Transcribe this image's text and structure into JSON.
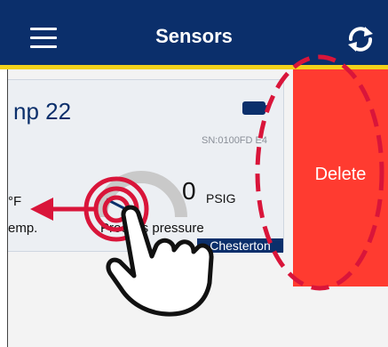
{
  "header": {
    "title": "Sensors",
    "menu_icon": "hamburger-menu-icon",
    "refresh_icon": "refresh-icon",
    "background_color": "#0b2f6b",
    "accent_color": "#f2d21b"
  },
  "sensor_card": {
    "title": "np 22",
    "battery_icon": "battery-icon",
    "serial": "SN:0100FD E4",
    "temperature": {
      "unit": "°F",
      "label": "emp."
    },
    "pressure": {
      "value": "0",
      "unit": "PSIG",
      "label": "Process pressure"
    },
    "brand": "Chesterton"
  },
  "swipe_action": {
    "label": "Delete",
    "color": "#ff3b30"
  },
  "tutorial_overlay": {
    "hand_icon": "hand-pointer-icon",
    "arrow_icon": "swipe-left-arrow-icon",
    "highlight_color": "#d9153a"
  }
}
